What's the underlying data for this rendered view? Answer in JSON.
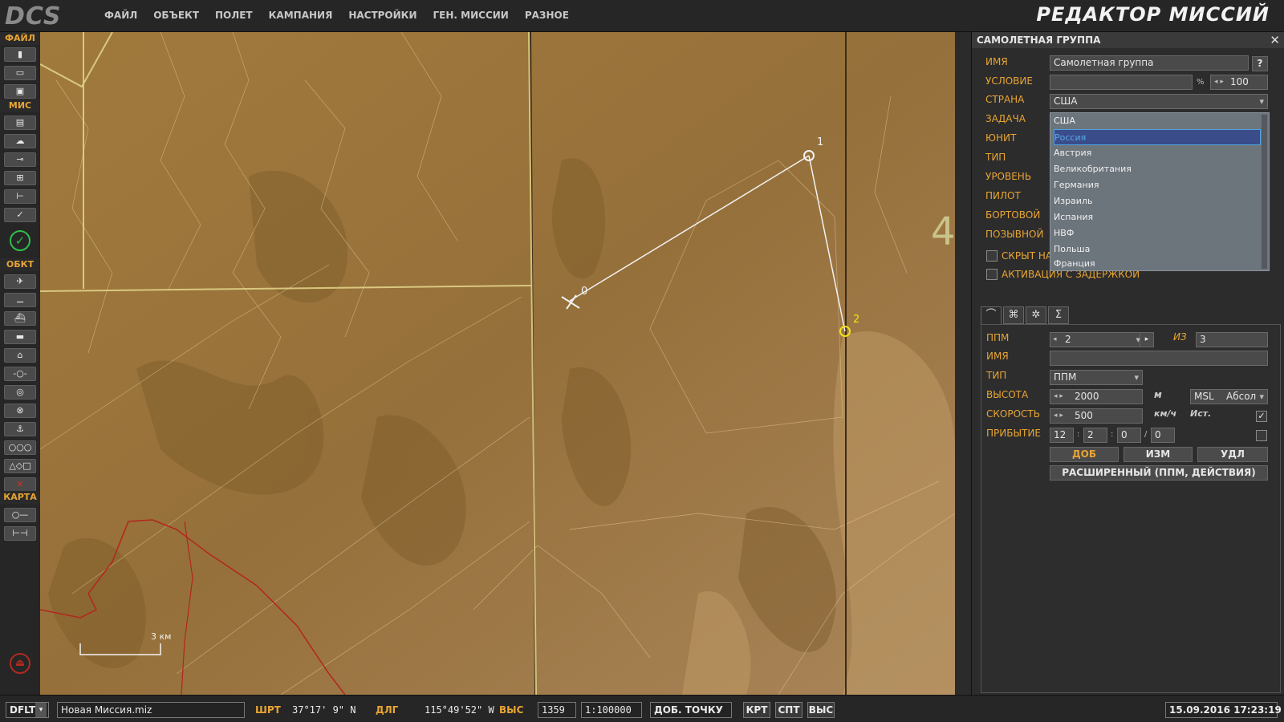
{
  "topbar": {
    "logo": "DCS",
    "menu": [
      "ФАЙЛ",
      "ОБЪЕКТ",
      "ПОЛЕТ",
      "КАМПАНИЯ",
      "НАСТРОЙКИ",
      "ГЕН. МИССИИ",
      "РАЗНОЕ"
    ],
    "app_title": "РЕДАКТОР МИССИЙ"
  },
  "left_toolbar": {
    "sections": [
      "ФАЙЛ",
      "МИС",
      "ОБКТ",
      "КАРТА"
    ],
    "icons": {
      "file": [
        "new-file-icon",
        "open-folder-icon",
        "save-icon"
      ],
      "mission": [
        "briefing-icon",
        "weather-icon",
        "triggers-icon",
        "failures-icon",
        "goals-icon",
        "check-icon",
        "mission-ok-icon"
      ],
      "objects": [
        "airplane-icon",
        "helicopter-icon",
        "ship-icon",
        "ground-unit-icon",
        "static-icon",
        "waypoint-icon",
        "trigger-zone-icon",
        "nav-point-icon",
        "bullseye-icon",
        "template-icon",
        "shapes-icon",
        "delete-icon"
      ],
      "map": [
        "map-options-icon",
        "ruler-icon"
      ]
    }
  },
  "map": {
    "waypoints": [
      {
        "label": "0"
      },
      {
        "label": "1"
      },
      {
        "label": "2"
      }
    ],
    "grid_label": "4",
    "scale_label": "3 км",
    "colors": {
      "terrain": "#9c7638",
      "route": "#f2f2f2",
      "selected": "#f2e21a",
      "boundary": "#b3261e"
    }
  },
  "panel": {
    "title": "САМОЛЕТНАЯ ГРУППА",
    "close": "✕",
    "fields": {
      "name_label": "ИМЯ",
      "name_value": "Самолетная группа",
      "help": "?",
      "condition_label": "УСЛОВИЕ",
      "condition_value": "",
      "percent": "%",
      "probability": "100",
      "country_label": "СТРАНА",
      "country_value": "США",
      "task_label": "ЗАДАЧА",
      "unit_label": "ЮНИТ",
      "type_label": "ТИП",
      "level_label": "УРОВЕНЬ",
      "pilot_label": "ПИЛОТ",
      "tail_label": "БОРТОВОЙ",
      "callsign_label": "ПОЗЫВНОЙ",
      "hidden_label": "СКРЫТ НА",
      "late_activation_label": "АКТИВАЦИЯ С ЗАДЕРЖКОЙ"
    },
    "country_options": [
      "США",
      "Россия",
      "Австрия",
      "Великобритания",
      "Германия",
      "Израиль",
      "Испания",
      "НВФ",
      "Польша",
      "Франция"
    ],
    "country_highlighted": "Россия",
    "tabs": [
      "route-tab-icon",
      "targets-tab-icon",
      "payload-tab-icon",
      "summary-tab-icon"
    ],
    "route": {
      "wp_label": "ППМ",
      "wp_value": "2",
      "of_label": "ИЗ",
      "of_value": "3",
      "name_label": "ИМЯ",
      "name_value": "",
      "type_label": "ТИП",
      "type_value": "ППМ",
      "alt_label": "ВЫСОТА",
      "alt_value": "2000",
      "alt_unit": "м",
      "alt_ref": "MSL",
      "alt_mode": "Абсол",
      "speed_label": "СКОРОСТЬ",
      "speed_value": "500",
      "speed_unit": "км/ч",
      "ist_label": "Ист.",
      "arrival_label": "ПРИБЫТИЕ",
      "arrival": [
        "12",
        "2",
        "0",
        "0"
      ],
      "add_btn": "ДОБ",
      "edit_btn": "ИЗМ",
      "del_btn": "УДЛ",
      "advanced_btn": "РАСШИРЕННЫЙ (ППМ, ДЕЙСТВИЯ)"
    }
  },
  "status": {
    "coalition": "DFLT",
    "filename": "Новая Миссия.miz",
    "lat_label": "ШРТ",
    "lat_value": "37°17' 9\" N",
    "lon_label": "ДЛГ",
    "lon_value": "115°49'52\" W",
    "alt_label": "ВЫС",
    "alt_value": "1359",
    "scale_value": "1:100000",
    "add_point": "ДОБ. ТОЧКУ",
    "btn_krt": "КРТ",
    "btn_spt": "СПТ",
    "btn_vys": "ВЫС",
    "datetime": "15.09.2016 17:23:19"
  }
}
